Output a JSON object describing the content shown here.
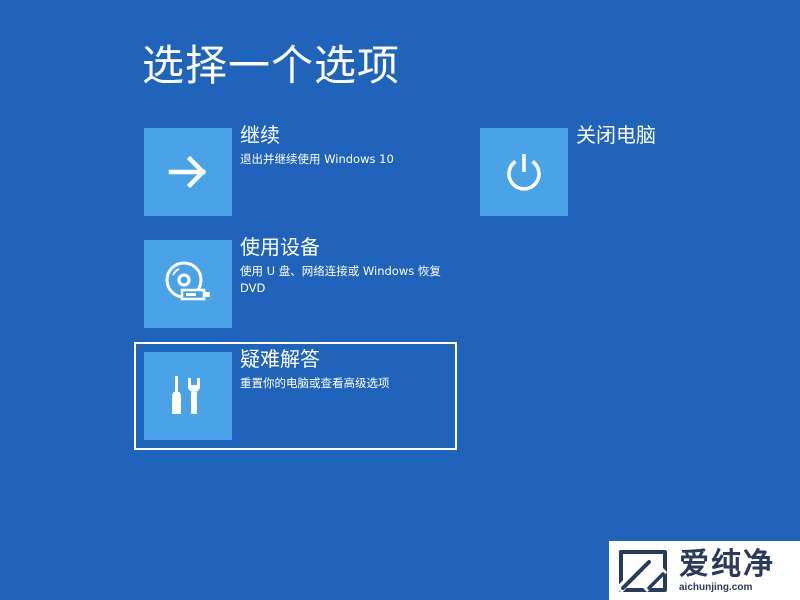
{
  "page": {
    "title": "选择一个选项"
  },
  "options": {
    "continue": {
      "title": "继续",
      "description": "退出并继续使用 Windows 10",
      "icon": "arrow-right-icon"
    },
    "shutdown": {
      "title": "关闭电脑",
      "icon": "power-icon"
    },
    "device": {
      "title": "使用设备",
      "description": "使用 U 盘、网络连接或 Windows 恢复 DVD",
      "icon": "disc-usb-icon"
    },
    "troubleshoot": {
      "title": "疑难解答",
      "description": "重置你的电脑或查看高级选项",
      "icon": "tools-icon",
      "selected": true
    }
  },
  "watermark": {
    "brand": "爱纯净",
    "domain": "aichunjing.com"
  },
  "colors": {
    "background": "#1f63ba",
    "tile": "#4aa3e6",
    "text": "#ffffff"
  }
}
